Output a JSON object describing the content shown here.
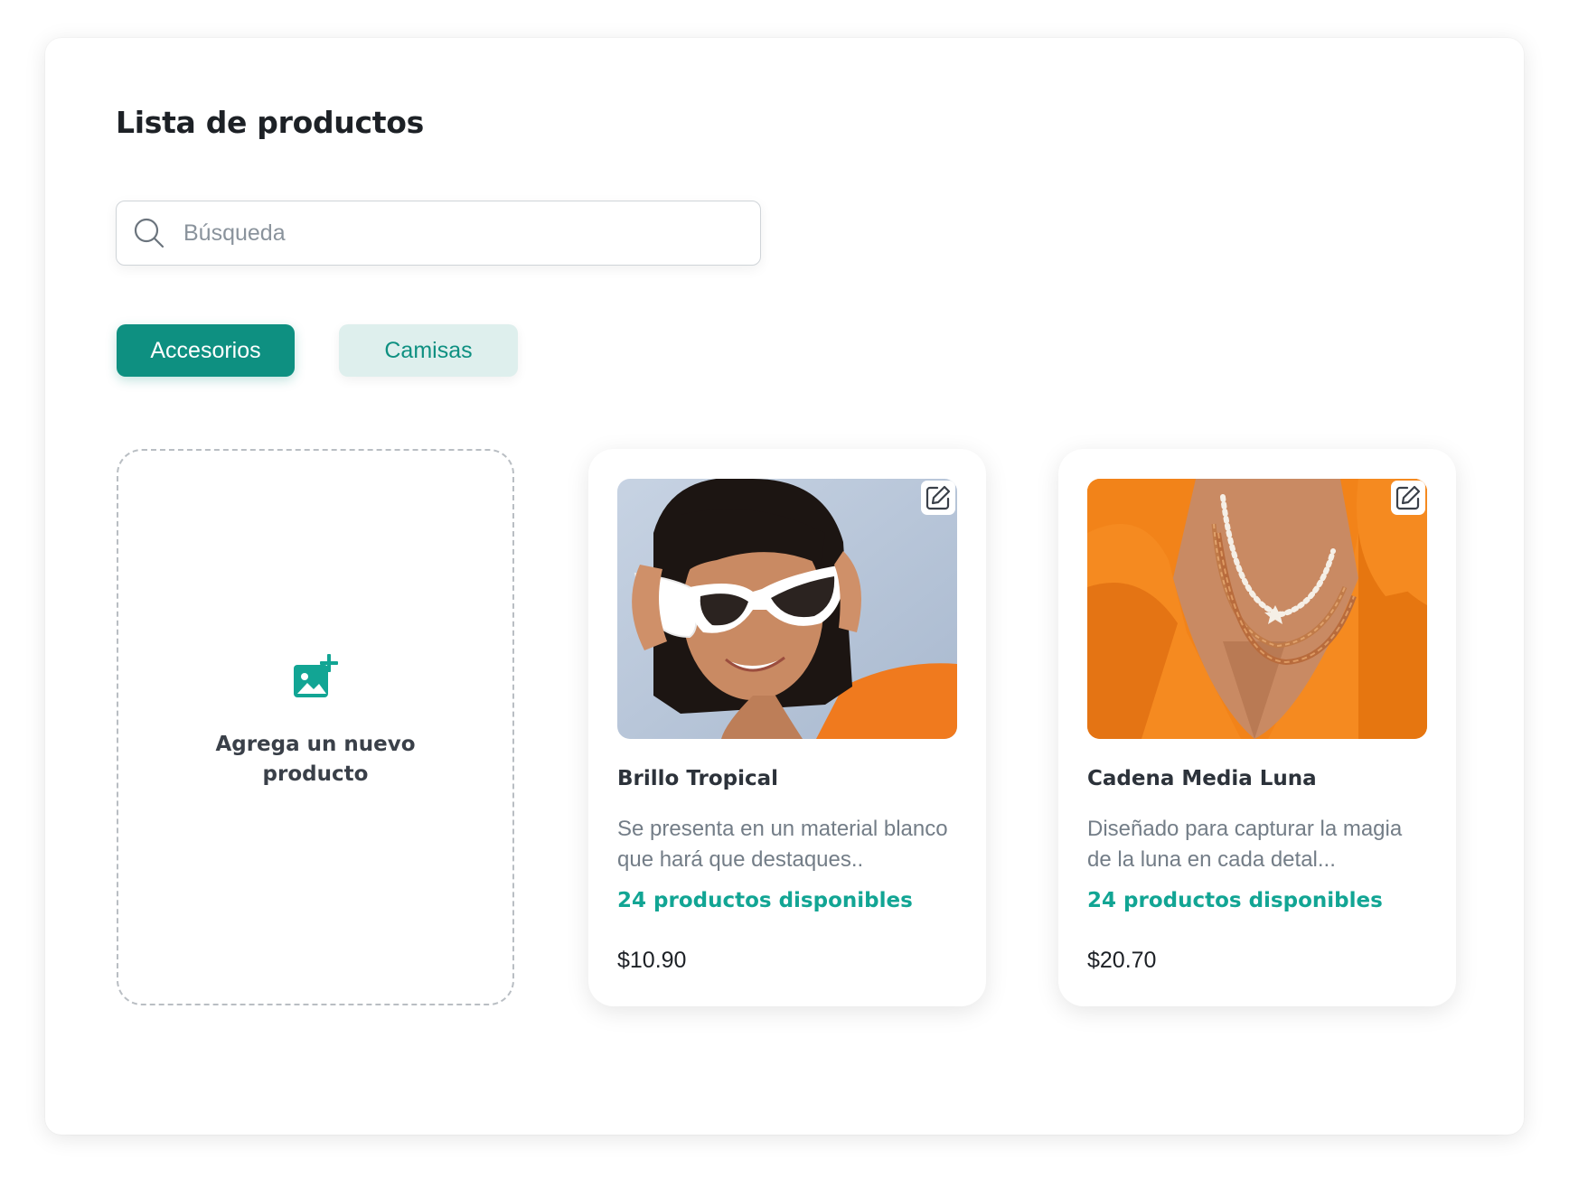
{
  "page": {
    "title": "Lista de productos"
  },
  "search": {
    "placeholder": "Búsqueda",
    "value": "",
    "icon": "search-icon"
  },
  "categories": [
    {
      "label": "Accesorios",
      "selected": true
    },
    {
      "label": "Camisas",
      "selected": false
    }
  ],
  "add_product": {
    "label": "Agrega un nuevo producto",
    "icon": "add-image-icon"
  },
  "products": [
    {
      "name": "Brillo Tropical",
      "description": "Se presenta en un material blanco que hará que destaques..",
      "stock": "24 productos disponibles",
      "price": "$10.90",
      "photo": "woman-white-cat-eye-sunglasses-photo"
    },
    {
      "name": "Cadena Media Luna",
      "description": "Diseñado para capturar la magia de la luna en cada detal...",
      "stock": "24 productos disponibles",
      "price": "$20.70",
      "photo": "layered-necklaces-orange-top-photo"
    }
  ],
  "colors": {
    "accent": "#0e9081",
    "accent_light": "#deefed",
    "stock_text": "#12a594",
    "heading": "#1d2126",
    "muted_text": "#737d87"
  }
}
